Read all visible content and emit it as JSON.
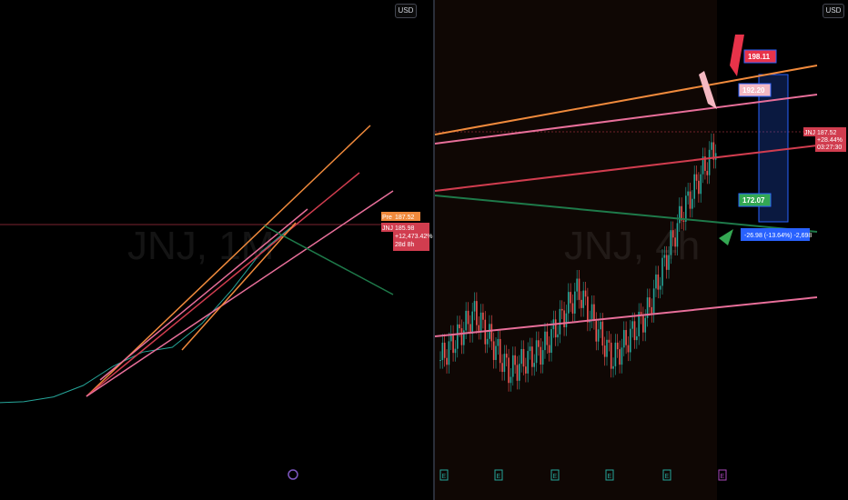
{
  "left_panel": {
    "currency": "USD",
    "watermark": "JNJ, 1M",
    "pre_label": "Pre",
    "pre_price": "187.52",
    "ticker": "JNJ",
    "price": "185.98",
    "change": "+12,473.42%",
    "countdown": "28d 8h",
    "colors": {
      "orange": "#f08a3c",
      "pink": "#e86f9a",
      "red": "#d13d4f",
      "green": "#1e7a4a"
    }
  },
  "right_panel": {
    "currency": "USD",
    "watermark": "JNJ, 4h",
    "upper_target": "198.11",
    "mid_target": "192.20",
    "lower_target": "172.07",
    "ticker": "JNJ",
    "price": "187.52",
    "change": "+28.44%",
    "countdown": "03:27:30",
    "measure": "-26.98 (-13.64%) -2,698",
    "earnings_marker": "E",
    "colors": {
      "orange": "#f08a3c",
      "pink": "#e86f9a",
      "red": "#d13d4f",
      "green": "#1e7a4a",
      "blue": "#2962ff"
    }
  },
  "chart_data": [
    {
      "type": "line",
      "title": "JNJ, 1M",
      "xlabel": "",
      "ylabel": "",
      "series": [
        {
          "name": "",
          "x": [
            1,
            5,
            10,
            15,
            20,
            25,
            30,
            35,
            40,
            45,
            50
          ],
          "values": [
            2,
            3,
            8,
            20,
            40,
            55,
            60,
            85,
            120,
            160,
            186
          ]
        }
      ]
    },
    {
      "type": "line",
      "title": "JNJ, 4h",
      "xlabel": "",
      "ylabel": "",
      "series": [
        {
          "name": "",
          "x": [
            1,
            5,
            10,
            15,
            20,
            25,
            30,
            35,
            40
          ],
          "values": [
            150,
            158,
            148,
            152,
            162,
            150,
            158,
            175,
            187
          ]
        }
      ]
    }
  ]
}
